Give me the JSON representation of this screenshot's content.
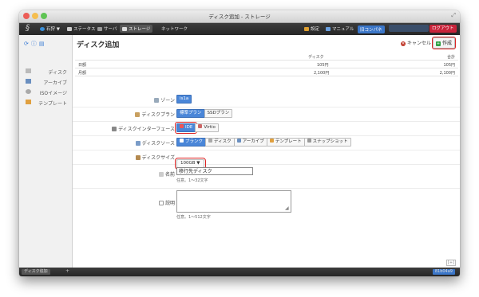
{
  "window": {
    "title": "ディスク追加 - ストレージ"
  },
  "nav": {
    "zone": "石狩 ▼",
    "status": "ステータス",
    "server": "サーバ",
    "storage": "ストレージ",
    "network": "ネットワーク",
    "settings": "設定",
    "manual": "マニュアル",
    "compat": "旧コンパネ",
    "logout": "ログアウト"
  },
  "sidebar": {
    "items": [
      {
        "label": "ディスク"
      },
      {
        "label": "アーカイブ"
      },
      {
        "label": "ISOイメージ"
      },
      {
        "label": "テンプレート"
      }
    ]
  },
  "page": {
    "title": "ディスク追加",
    "cancel_label": "キャンセル",
    "create_label": "作成"
  },
  "price_table": {
    "headers": {
      "disk": "ディスク",
      "total": "合計"
    },
    "rows": [
      {
        "label": "日額",
        "disk": "105円",
        "total": "105円"
      },
      {
        "label": "月額",
        "disk": "2,100円",
        "total": "2,100円"
      }
    ]
  },
  "form": {
    "zone": {
      "label": "ゾーン",
      "value": "is1a"
    },
    "plan": {
      "label": "ディスクプラン",
      "options": [
        "標準プラン",
        "SSDプラン"
      ],
      "selected": "標準プラン"
    },
    "interface": {
      "label": "ディスクインターフェース",
      "options": [
        "IDE",
        "Virtio"
      ],
      "selected": "IDE"
    },
    "source": {
      "label": "ディスクソース",
      "options": [
        "ブランク",
        "ディスク",
        "アーカイブ",
        "テンプレート",
        "スナップショット"
      ],
      "selected": "ブランク"
    },
    "size": {
      "label": "ディスクサイズ",
      "value": "100GB"
    },
    "name": {
      "label": "名前",
      "value": "移行先ディスク",
      "hint": "任意。1〜32文字"
    },
    "description": {
      "label": "説明",
      "value": "",
      "hint": "任意。1〜512文字"
    }
  },
  "bottombar": {
    "tab_label": "ディスク追加",
    "add_label": "+",
    "resource_id": "81b04a9"
  },
  "colors": {
    "accent": "#4a86d8",
    "logout": "#c8233a",
    "highlight": "#dd2222"
  }
}
